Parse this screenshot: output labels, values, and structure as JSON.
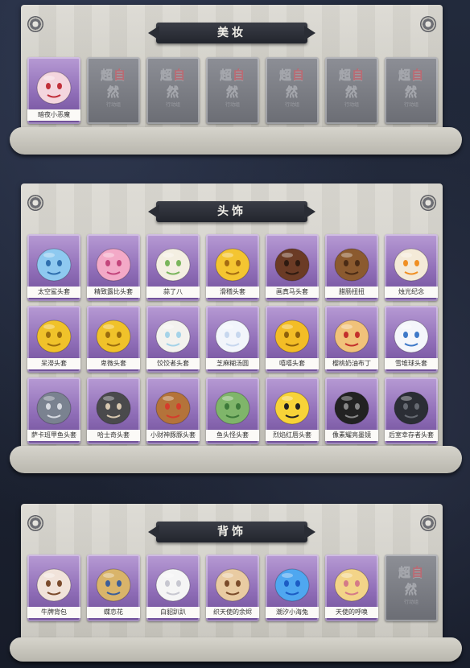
{
  "sections": [
    {
      "title": "美妆",
      "items": [
        {
          "name": "暗夜小恶魔",
          "icon": "dark-devil-makeup-icon",
          "locked": false
        },
        {
          "name": "",
          "icon": "locked-logo-icon",
          "locked": true
        },
        {
          "name": "",
          "icon": "locked-logo-icon",
          "locked": true
        },
        {
          "name": "",
          "icon": "locked-logo-icon",
          "locked": true
        },
        {
          "name": "",
          "icon": "locked-logo-icon",
          "locked": true
        },
        {
          "name": "",
          "icon": "locked-logo-icon",
          "locked": true
        },
        {
          "name": "",
          "icon": "locked-logo-icon",
          "locked": true
        }
      ]
    },
    {
      "title": "头饰",
      "items": [
        {
          "name": "太空鲨头套",
          "icon": "space-shark-helmet-icon",
          "locked": false
        },
        {
          "name": "精致露比头套",
          "icon": "pink-ruby-helmet-icon",
          "locked": false
        },
        {
          "name": "蒜了八",
          "icon": "garlic-head-icon",
          "locked": false
        },
        {
          "name": "滑稽头套",
          "icon": "funny-face-helmet-icon",
          "locked": false
        },
        {
          "name": "画真马头套",
          "icon": "horse-head-mask-icon",
          "locked": false
        },
        {
          "name": "腊肠扭扭",
          "icon": "dachshund-head-icon",
          "locked": false
        },
        {
          "name": "烛光纪念",
          "icon": "candle-head-icon",
          "locked": false
        },
        {
          "name": "呆滞头套",
          "icon": "dazed-face-helmet-icon",
          "locked": false
        },
        {
          "name": "卑微头套",
          "icon": "humble-face-helmet-icon",
          "locked": false
        },
        {
          "name": "饺饺者头套",
          "icon": "dumpling-head-icon",
          "locked": false
        },
        {
          "name": "芝麻糊汤圆",
          "icon": "sesame-dumpling-head-icon",
          "locked": false
        },
        {
          "name": "嘻嘻头套",
          "icon": "grinning-face-helmet-icon",
          "locked": false
        },
        {
          "name": "樱桃奶油布丁",
          "icon": "cherry-pudding-head-icon",
          "locked": false
        },
        {
          "name": "雪堆球头套",
          "icon": "snowman-head-icon",
          "locked": false
        },
        {
          "name": "萨卡班甲鱼头套",
          "icon": "sacabambaspis-head-icon",
          "locked": false
        },
        {
          "name": "哈士奇头套",
          "icon": "husky-head-icon",
          "locked": false
        },
        {
          "name": "小财神豚豚头套",
          "icon": "capybara-fortune-head-icon",
          "locked": false
        },
        {
          "name": "鱼头怪头套",
          "icon": "fish-monster-head-icon",
          "locked": false
        },
        {
          "name": "烈焰红唇头套",
          "icon": "pikachu-sunglasses-head-icon",
          "locked": false
        },
        {
          "name": "像素耀亮墨镜",
          "icon": "pixel-sunglasses-icon",
          "locked": false
        },
        {
          "name": "后室幸存者头套",
          "icon": "gas-mask-helmet-icon",
          "locked": false
        }
      ]
    },
    {
      "title": "背饰",
      "items": [
        {
          "name": "牛牌背包",
          "icon": "cow-backpack-icon",
          "locked": false
        },
        {
          "name": "蝶恋花",
          "icon": "butterfly-flower-icon",
          "locked": false
        },
        {
          "name": "白貂趴趴",
          "icon": "white-ferret-icon",
          "locked": false
        },
        {
          "name": "织天使的余烬",
          "icon": "angel-doll-icon",
          "locked": false
        },
        {
          "name": "潮汐小海兔",
          "icon": "blue-sea-bunny-icon",
          "locked": false
        },
        {
          "name": "天使的呼唤",
          "icon": "angel-call-doll-icon",
          "locked": false
        },
        {
          "name": "",
          "icon": "locked-logo-icon",
          "locked": true
        }
      ]
    }
  ],
  "locked_logo": {
    "big_a": "超",
    "big_mid": "自",
    "big_b": "然",
    "small": "行动组"
  }
}
